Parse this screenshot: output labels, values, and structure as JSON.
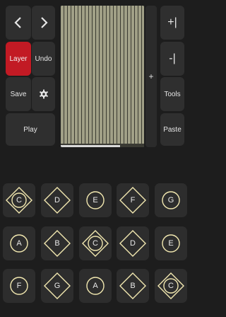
{
  "toolbar": {
    "layer_label": "Layer",
    "undo_label": "Undo",
    "save_label": "Save",
    "play_label": "Play"
  },
  "side": {
    "add_column_label": "+|",
    "remove_column_label": "-|",
    "tools_label": "Tools",
    "paste_label": "Paste",
    "divider_label": "+"
  },
  "colors": {
    "background": "#1d1d1d",
    "button": "#2f2f2f",
    "layer_active": "#c21a24",
    "grid": "#a1a087",
    "note_outline": "#f2e8b0"
  },
  "notes": [
    {
      "label": "C",
      "shape": "diamond-circle"
    },
    {
      "label": "D",
      "shape": "diamond"
    },
    {
      "label": "E",
      "shape": "circle"
    },
    {
      "label": "F",
      "shape": "diamond"
    },
    {
      "label": "G",
      "shape": "circle"
    },
    {
      "label": "A",
      "shape": "circle"
    },
    {
      "label": "B",
      "shape": "diamond"
    },
    {
      "label": "C",
      "shape": "diamond-circle"
    },
    {
      "label": "D",
      "shape": "diamond"
    },
    {
      "label": "E",
      "shape": "circle"
    },
    {
      "label": "F",
      "shape": "circle"
    },
    {
      "label": "G",
      "shape": "diamond"
    },
    {
      "label": "A",
      "shape": "circle"
    },
    {
      "label": "B",
      "shape": "diamond"
    },
    {
      "label": "C",
      "shape": "diamond-circle"
    }
  ]
}
